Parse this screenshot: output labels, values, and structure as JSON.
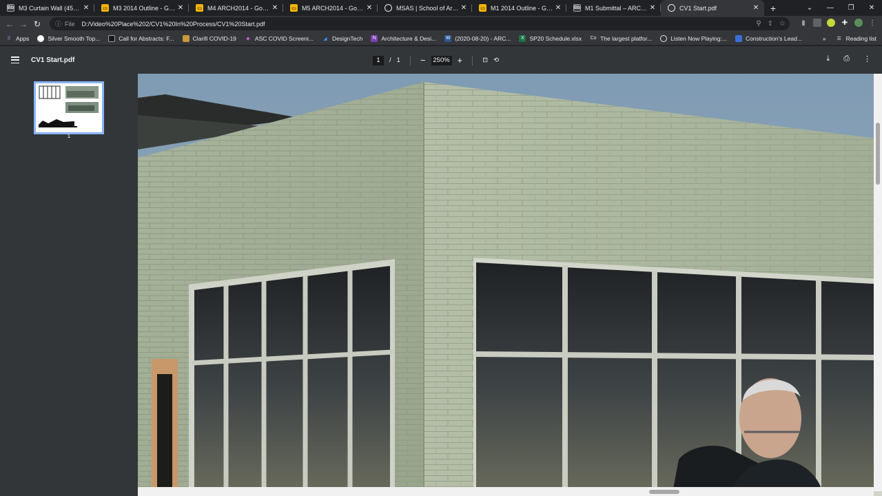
{
  "tabs": [
    {
      "title": "M3 Curtain Wall (45min) -",
      "icon": "blackboard-icon"
    },
    {
      "title": "M3 2014 Outline - Google",
      "icon": "slides-icon"
    },
    {
      "title": "M4 ARCH2014 - Google S",
      "icon": "slides-icon"
    },
    {
      "title": "M5 ARCH2014 - Google S",
      "icon": "slides-icon"
    },
    {
      "title": "MSAS | School of Architec",
      "icon": "globe-icon"
    },
    {
      "title": "M1 2014 Outline - Google",
      "icon": "slides-icon"
    },
    {
      "title": "M1 Submittal – ARCH_20",
      "icon": "blackboard-icon"
    },
    {
      "title": "CV1 Start.pdf",
      "icon": "globe-icon",
      "active": true
    }
  ],
  "address": {
    "scheme_label": "File",
    "url": "D:/Video%20Place%202/CV1%20In%20Process/CV1%20Start.pdf"
  },
  "bookmarks": [
    {
      "label": "Apps",
      "icon": "apps-grid-icon"
    },
    {
      "label": "Silver Smooth Top...",
      "icon": "circle-icon"
    },
    {
      "label": "Call for Abstracts: F...",
      "icon": "page-icon"
    },
    {
      "label": "Clarifi COVID-19",
      "icon": "page-icon"
    },
    {
      "label": "ASC COVID Screeni...",
      "icon": "diamond-icon"
    },
    {
      "label": "DesignTech",
      "icon": "triangle-icon"
    },
    {
      "label": "Architecture & Desi...",
      "icon": "onenote-icon"
    },
    {
      "label": "(2020-08-20) - ARC...",
      "icon": "word-icon"
    },
    {
      "label": "SP20 Schedule.xlsx",
      "icon": "excel-icon"
    },
    {
      "label": "The largest platfor...",
      "icon": "co-icon"
    },
    {
      "label": "Listen Now Playing:...",
      "icon": "globe-icon"
    },
    {
      "label": "Construction's Lead...",
      "icon": "page-icon"
    }
  ],
  "reading_list": "Reading list",
  "pdf": {
    "title": "CV1 Start.pdf",
    "current_page": "1",
    "page_separator": "/",
    "total_pages": "1",
    "zoom": "250%",
    "thumbnail_label": "1"
  },
  "colors": {
    "accent": "#8ab4f8",
    "toolbar": "#323639",
    "viewer_bg": "#525659"
  }
}
